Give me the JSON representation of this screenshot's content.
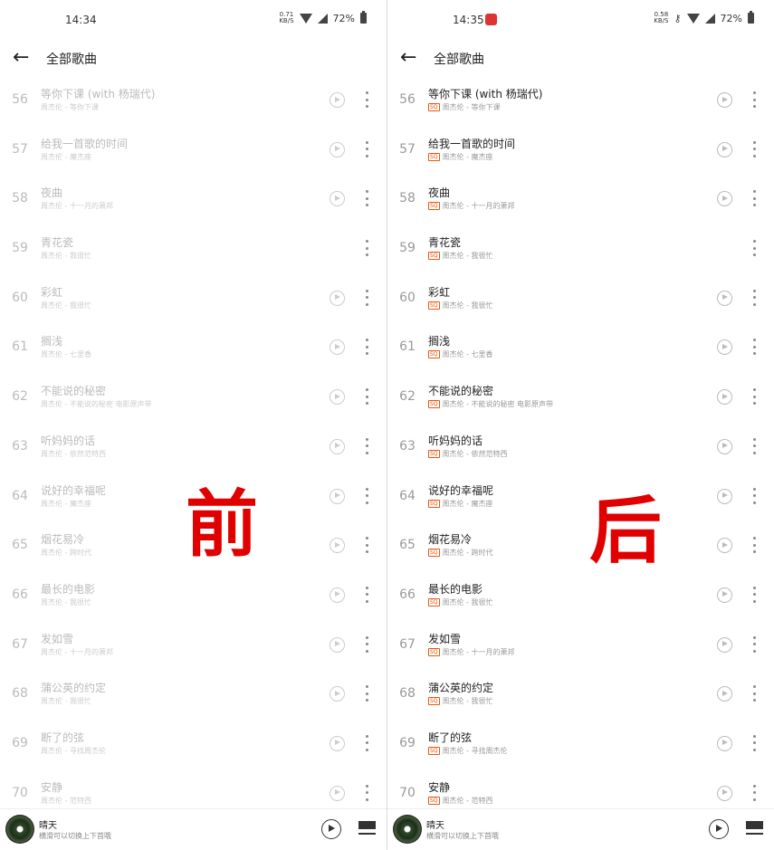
{
  "left": {
    "status": {
      "time": "14:34",
      "netspeed_value": "0.71",
      "netspeed_unit": "KB/S",
      "battery": "72%"
    },
    "header": {
      "back_icon": "arrow-left-icon",
      "title": "全部歌曲"
    },
    "songs": [
      {
        "num": "56",
        "title": "等你下课 (with 杨瑞代)",
        "subtitle": "周杰伦 - 等你下课",
        "has_play": true
      },
      {
        "num": "57",
        "title": "给我一首歌的时间",
        "subtitle": "周杰伦 - 魔杰座",
        "has_play": true
      },
      {
        "num": "58",
        "title": "夜曲",
        "subtitle": "周杰伦 - 十一月的萧邦",
        "has_play": true
      },
      {
        "num": "59",
        "title": "青花瓷",
        "subtitle": "周杰伦 - 我很忙",
        "has_play": false
      },
      {
        "num": "60",
        "title": "彩虹",
        "subtitle": "周杰伦 - 我很忙",
        "has_play": true
      },
      {
        "num": "61",
        "title": "搁浅",
        "subtitle": "周杰伦 - 七里香",
        "has_play": true
      },
      {
        "num": "62",
        "title": "不能说的秘密",
        "subtitle": "周杰伦 - 不能说的秘密 电影原声带",
        "has_play": true
      },
      {
        "num": "63",
        "title": "听妈妈的话",
        "subtitle": "周杰伦 - 依然范特西",
        "has_play": true
      },
      {
        "num": "64",
        "title": "说好的幸福呢",
        "subtitle": "周杰伦 - 魔杰座",
        "has_play": true
      },
      {
        "num": "65",
        "title": "烟花易冷",
        "subtitle": "周杰伦 - 跨时代",
        "has_play": true
      },
      {
        "num": "66",
        "title": "最长的电影",
        "subtitle": "周杰伦 - 我很忙",
        "has_play": true
      },
      {
        "num": "67",
        "title": "发如雪",
        "subtitle": "周杰伦 - 十一月的萧邦",
        "has_play": true
      },
      {
        "num": "68",
        "title": "蒲公英的约定",
        "subtitle": "周杰伦 - 我很忙",
        "has_play": true
      },
      {
        "num": "69",
        "title": "断了的弦",
        "subtitle": "周杰伦 - 寻找周杰伦",
        "has_play": true
      },
      {
        "num": "70",
        "title": "安静",
        "subtitle": "周杰伦 - 范特西",
        "has_play": true
      }
    ],
    "now_playing": {
      "title": "晴天",
      "subtitle": "横滑可以切换上下首哦"
    },
    "overlay": "前"
  },
  "right": {
    "status": {
      "time": "14:35",
      "netspeed_value": "0.58",
      "netspeed_unit": "KB/S",
      "battery": "72%"
    },
    "header": {
      "back_icon": "arrow-left-icon",
      "title": "全部歌曲"
    },
    "badge": "SQ",
    "songs": [
      {
        "num": "56",
        "title": "等你下课 (with 杨瑞代)",
        "subtitle": "周杰伦 - 等你下课",
        "has_play": true
      },
      {
        "num": "57",
        "title": "给我一首歌的时间",
        "subtitle": "周杰伦 - 魔杰座",
        "has_play": true
      },
      {
        "num": "58",
        "title": "夜曲",
        "subtitle": "周杰伦 - 十一月的萧邦",
        "has_play": true
      },
      {
        "num": "59",
        "title": "青花瓷",
        "subtitle": "周杰伦 - 我很忙",
        "has_play": false
      },
      {
        "num": "60",
        "title": "彩虹",
        "subtitle": "周杰伦 - 我很忙",
        "has_play": true
      },
      {
        "num": "61",
        "title": "搁浅",
        "subtitle": "周杰伦 - 七里香",
        "has_play": true
      },
      {
        "num": "62",
        "title": "不能说的秘密",
        "subtitle": "周杰伦 - 不能说的秘密 电影原声带",
        "has_play": true
      },
      {
        "num": "63",
        "title": "听妈妈的话",
        "subtitle": "周杰伦 - 依然范特西",
        "has_play": true
      },
      {
        "num": "64",
        "title": "说好的幸福呢",
        "subtitle": "周杰伦 - 魔杰座",
        "has_play": true
      },
      {
        "num": "65",
        "title": "烟花易冷",
        "subtitle": "周杰伦 - 跨时代",
        "has_play": true
      },
      {
        "num": "66",
        "title": "最长的电影",
        "subtitle": "周杰伦 - 我很忙",
        "has_play": true
      },
      {
        "num": "67",
        "title": "发如雪",
        "subtitle": "周杰伦 - 十一月的萧邦",
        "has_play": true
      },
      {
        "num": "68",
        "title": "蒲公英的约定",
        "subtitle": "周杰伦 - 我很忙",
        "has_play": true
      },
      {
        "num": "69",
        "title": "断了的弦",
        "subtitle": "周杰伦 - 寻找周杰伦",
        "has_play": true
      },
      {
        "num": "70",
        "title": "安静",
        "subtitle": "周杰伦 - 范特西",
        "has_play": true
      }
    ],
    "now_playing": {
      "title": "晴天",
      "subtitle": "横滑可以切换上下首哦"
    },
    "overlay": "后"
  }
}
